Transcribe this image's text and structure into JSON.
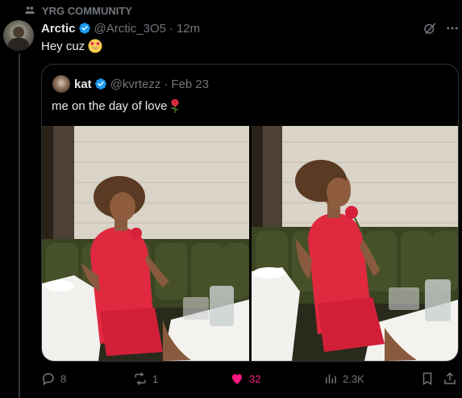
{
  "context": {
    "label": "YRG COMMUNITY",
    "icon": "community-icon"
  },
  "tweet": {
    "author_name": "Arctic",
    "handle": "@Arctic_3O5",
    "time": "12m",
    "text": "Hey cuz",
    "emoji": "heart-eyes-emoji"
  },
  "quote": {
    "author_name": "kat",
    "handle": "@kvrtezz",
    "date": "Feb 23",
    "text": "me on the day of love",
    "emoji": "rose-emoji",
    "media_count": 2
  },
  "actions": {
    "replies": "8",
    "reposts": "1",
    "likes": "32",
    "views": "2.3K"
  },
  "colors": {
    "accent": "#1d9bf0",
    "like": "#f91880",
    "muted": "#71767b",
    "border": "#2f3336"
  }
}
